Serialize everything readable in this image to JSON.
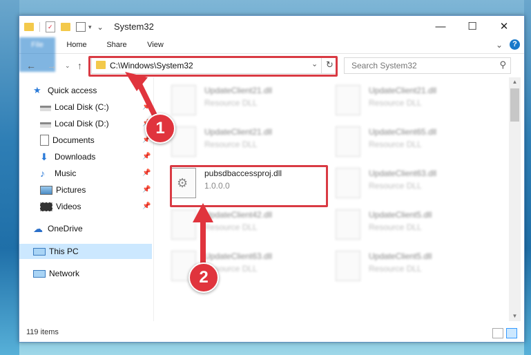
{
  "window": {
    "title": "System32",
    "minimize_glyph": "—",
    "maximize_glyph": "☐",
    "close_glyph": "✕"
  },
  "ribbon": {
    "tabs": [
      "File",
      "Home",
      "Share",
      "View"
    ],
    "collapse_glyph": "⌄",
    "help_glyph": "?"
  },
  "address": {
    "path": "C:\\Windows\\System32",
    "search_placeholder": "Search System32"
  },
  "sidebar": {
    "items": [
      {
        "label": "Quick access",
        "icon": "star-icon",
        "pinned": false
      },
      {
        "label": "Local Disk (C:)",
        "icon": "drive-icon",
        "pinned": true
      },
      {
        "label": "Local Disk (D:)",
        "icon": "drive-icon",
        "pinned": true
      },
      {
        "label": "Documents",
        "icon": "documents-icon",
        "pinned": true
      },
      {
        "label": "Downloads",
        "icon": "download-icon",
        "pinned": true
      },
      {
        "label": "Music",
        "icon": "music-icon",
        "pinned": true
      },
      {
        "label": "Pictures",
        "icon": "pictures-icon",
        "pinned": true
      },
      {
        "label": "Videos",
        "icon": "videos-icon",
        "pinned": true
      },
      {
        "label": "OneDrive",
        "icon": "cloud-icon",
        "pinned": false
      },
      {
        "label": "This PC",
        "icon": "computer-icon",
        "pinned": false,
        "selected": true
      },
      {
        "label": "Network",
        "icon": "network-icon",
        "pinned": false
      }
    ]
  },
  "files": [
    {
      "name": "UpdateClient21.dll",
      "desc": "Resource DLL"
    },
    {
      "name": "UpdateClient21.dll",
      "desc": "Resource DLL"
    },
    {
      "name": "UpdateClient21.dll",
      "desc": "Resource DLL"
    },
    {
      "name": "UpdateClient65.dll",
      "desc": "Resource DLL"
    },
    {
      "name": "pubsdbaccessproj.dll",
      "desc": "1.0.0.0",
      "highlighted": true
    },
    {
      "name": "UpdateClient63.dll",
      "desc": "Resource DLL"
    },
    {
      "name": "UpdateClient42.dll",
      "desc": "Resource DLL"
    },
    {
      "name": "UpdateClient5.dll",
      "desc": "Resource DLL"
    },
    {
      "name": "UpdateClient63.dll",
      "desc": "Resource DLL"
    },
    {
      "name": "UpdateClient5.dll",
      "desc": "Resource DLL"
    }
  ],
  "status": {
    "item_count": "119 items"
  },
  "callouts": {
    "one": "1",
    "two": "2"
  },
  "colors": {
    "accent": "#1979ca",
    "highlight": "#d93a43",
    "selection": "#cce8ff"
  }
}
